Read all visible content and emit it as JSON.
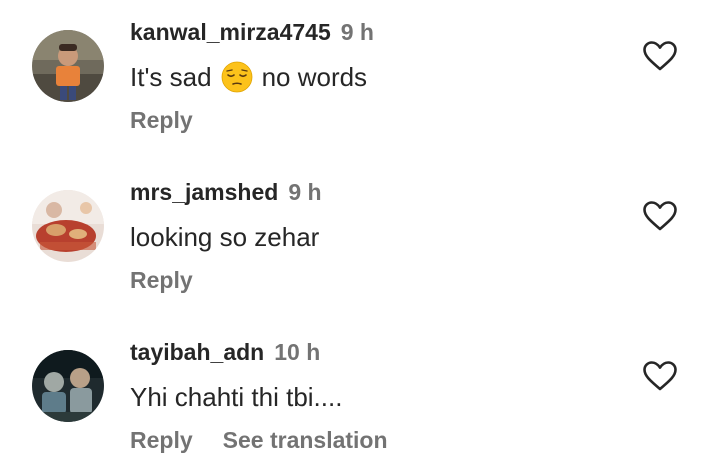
{
  "comments": [
    {
      "username": "kanwal_mirza4745",
      "time": "9 h",
      "text_before": "It's sad",
      "emoji": "pensive-face-emoji",
      "text_after": "no words",
      "reply_label": "Reply",
      "avatar_icon": "child-photo-avatar",
      "like_icon": "heart-outline-icon"
    },
    {
      "username": "mrs_jamshed",
      "time": "9 h",
      "text": "looking so zehar",
      "reply_label": "Reply",
      "avatar_icon": "bridal-photo-avatar",
      "like_icon": "heart-outline-icon"
    },
    {
      "username": "tayibah_adn",
      "time": "10 h",
      "text": "Yhi chahti thi tbi....",
      "reply_label": "Reply",
      "translation_label": "See translation",
      "avatar_icon": "group-photo-avatar",
      "like_icon": "heart-outline-icon"
    }
  ],
  "colors": {
    "primary_text": "#262626",
    "secondary_text": "#737373",
    "background": "#ffffff"
  }
}
